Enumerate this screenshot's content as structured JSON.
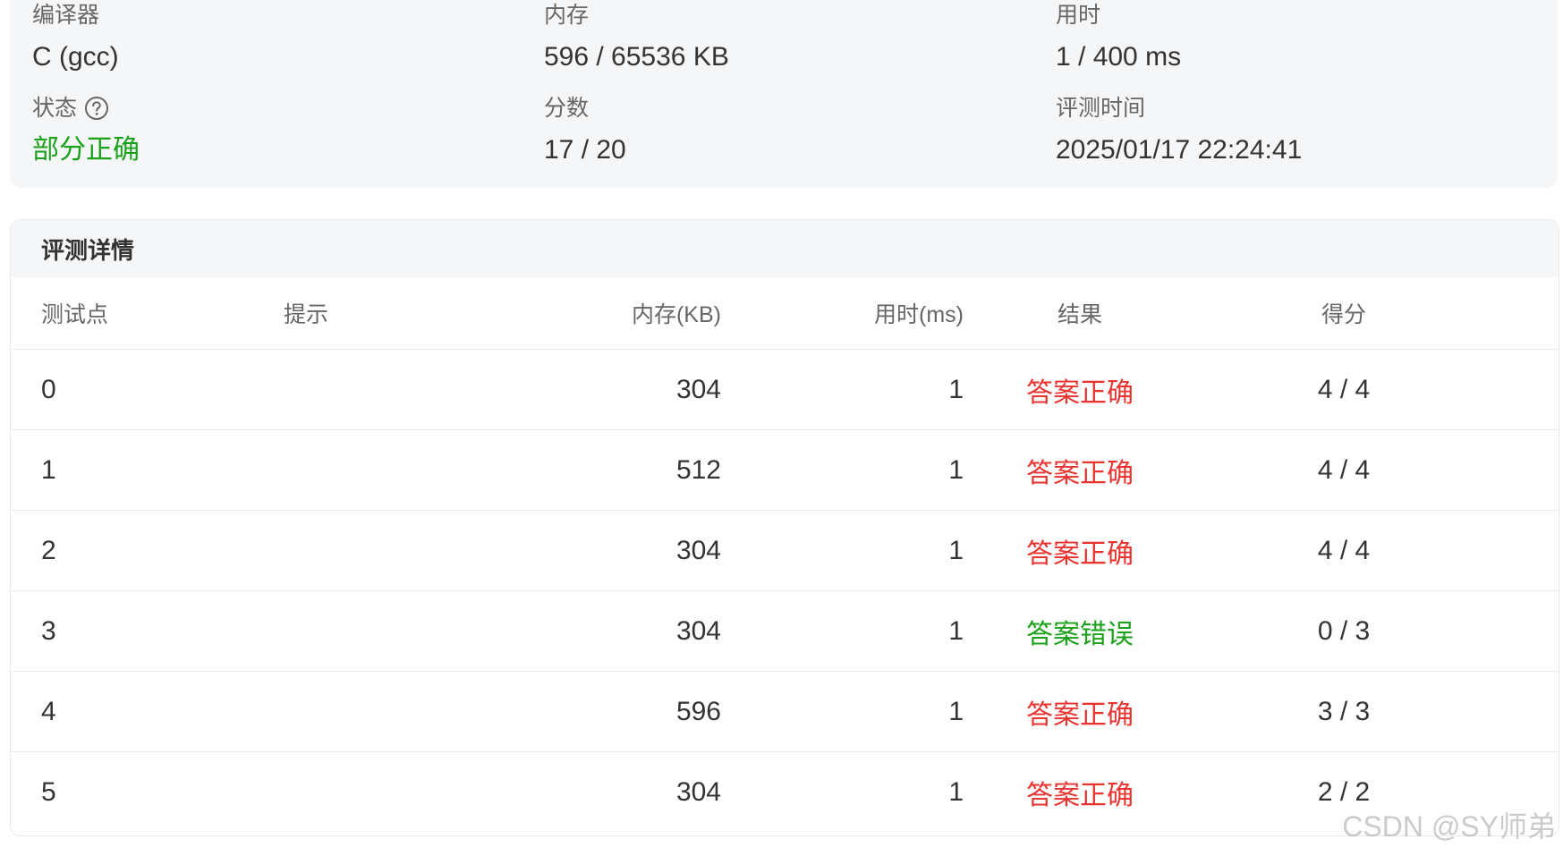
{
  "summary": {
    "compiler": {
      "label": "编译器",
      "value": "C (gcc)"
    },
    "memory": {
      "label": "内存",
      "value": "596 / 65536 KB"
    },
    "time": {
      "label": "用时",
      "value": "1 / 400 ms"
    },
    "status": {
      "label": "状态",
      "value": "部分正确",
      "icon": "question-circle-icon"
    },
    "score": {
      "label": "分数",
      "value": "17 / 20"
    },
    "judged_at": {
      "label": "评测时间",
      "value": "2025/01/17 22:24:41"
    }
  },
  "details": {
    "title": "评测详情",
    "columns": {
      "id": "测试点",
      "hint": "提示",
      "memory": "内存(KB)",
      "time": "用时(ms)",
      "result": "结果",
      "score": "得分"
    },
    "rows": [
      {
        "id": "0",
        "hint": "",
        "memory": "304",
        "time": "1",
        "result": "答案正确",
        "result_status": "ok",
        "score": "4 / 4"
      },
      {
        "id": "1",
        "hint": "",
        "memory": "512",
        "time": "1",
        "result": "答案正确",
        "result_status": "ok",
        "score": "4 / 4"
      },
      {
        "id": "2",
        "hint": "",
        "memory": "304",
        "time": "1",
        "result": "答案正确",
        "result_status": "ok",
        "score": "4 / 4"
      },
      {
        "id": "3",
        "hint": "",
        "memory": "304",
        "time": "1",
        "result": "答案错误",
        "result_status": "bad",
        "score": "0 / 3"
      },
      {
        "id": "4",
        "hint": "",
        "memory": "596",
        "time": "1",
        "result": "答案正确",
        "result_status": "ok",
        "score": "3 / 3"
      },
      {
        "id": "5",
        "hint": "",
        "memory": "304",
        "time": "1",
        "result": "答案正确",
        "result_status": "ok",
        "score": "2 / 2"
      }
    ]
  },
  "watermark": "CSDN @SY师弟",
  "colors": {
    "correct": "#e8332f",
    "wrong": "#1aa11a",
    "partial_status": "#1aa11a",
    "card_bg": "#f5f6f7"
  }
}
